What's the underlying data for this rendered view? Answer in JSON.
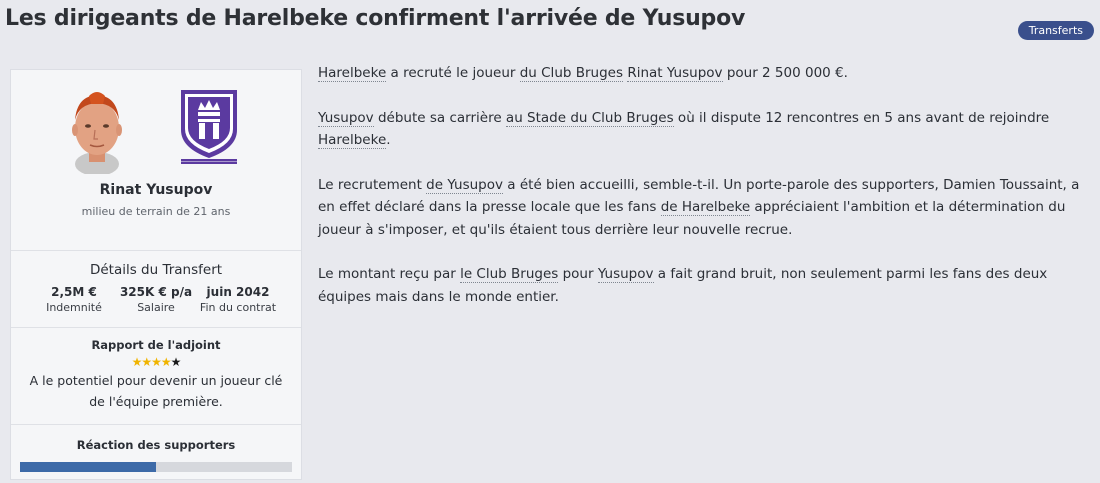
{
  "headline": "Les dirigeants de Harelbeke confirment l'arrivée de Yusupov",
  "tag": "Transferts",
  "player": {
    "name": "Rinat Yusupov",
    "description": "milieu de terrain de 21 ans"
  },
  "transfer": {
    "title": "Détails du Transfert",
    "stats": [
      {
        "value": "2,5M €",
        "label": "Indemnité"
      },
      {
        "value": "325K € p/a",
        "label": "Salaire"
      },
      {
        "value": "juin 2042",
        "label": "Fin du contrat"
      }
    ]
  },
  "report": {
    "title": "Rapport de l'adjoint",
    "stars_filled": 4,
    "stars_total": 5,
    "text": "A le potentiel pour devenir un joueur clé de l'équipe première."
  },
  "supporters": {
    "title": "Réaction des supporters",
    "level": 0.5
  },
  "article": {
    "p1": {
      "club": "Harelbeke",
      "t1": " a recruté le joueur ",
      "from_club": "du Club Bruges",
      "t2": " ",
      "player": "Rinat Yusupov",
      "t3": " pour 2 500 000 €."
    },
    "p2": {
      "player": "Yusupov",
      "t1": " débute sa carrière ",
      "stadium": "au Stade du Club Bruges",
      "t2": " où il dispute 12 rencontres en 5 ans avant de rejoindre ",
      "club": "Harelbeke",
      "t3": "."
    },
    "p3": {
      "t1": "Le recrutement ",
      "player": "de Yusupov",
      "t2": " a été bien accueilli, semble-t-il. Un porte-parole des supporters, Damien Toussaint, a en effet déclaré dans la presse locale que les fans ",
      "club": "de Harelbeke",
      "t3": " appréciaient l'ambition et la détermination du joueur à s'imposer, et qu'ils étaient tous derrière leur nouvelle recrue."
    },
    "p4": {
      "t1": "Le montant reçu par ",
      "club": "le Club Bruges",
      "t2": " pour ",
      "player": "Yusupov",
      "t3": " a fait grand bruit, non seulement parmi les fans des deux équipes mais dans le monde entier."
    }
  },
  "colors": {
    "tag_bg": "#3a4f8c",
    "badge": "#5b3aa0",
    "star": "#f0b400",
    "bar": "#3d6aa8"
  }
}
